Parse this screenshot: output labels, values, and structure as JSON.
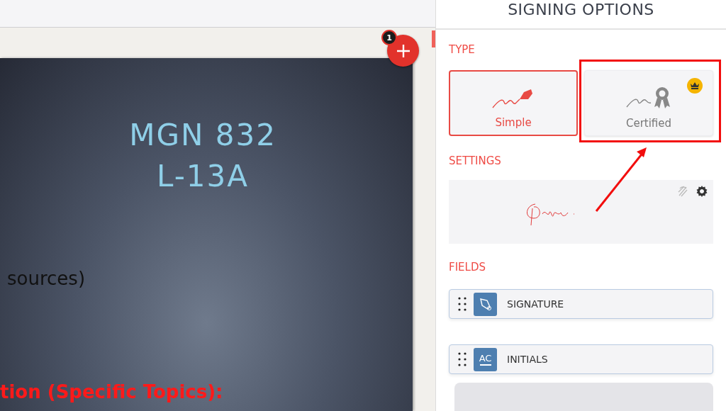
{
  "document": {
    "slide": {
      "title_lines": [
        "MGN 832",
        "L-13A"
      ],
      "body_text": "sources)",
      "heading_text": "tion (Specific Topics):"
    },
    "add_button": {
      "badge": "1"
    }
  },
  "panel": {
    "title": "SIGNING OPTIONS",
    "type_section": {
      "label": "TYPE",
      "options": [
        {
          "label": "Simple",
          "kind": "pen",
          "selected": true,
          "premium": false
        },
        {
          "label": "Certified",
          "kind": "seal",
          "selected": false,
          "premium": true
        }
      ]
    },
    "settings_section": {
      "label": "SETTINGS"
    },
    "fields_section": {
      "label": "FIELDS",
      "fields": [
        {
          "label": "SIGNATURE",
          "kind": "signature"
        },
        {
          "label": "INITIALS",
          "kind": "initials",
          "icon_text": "AC"
        }
      ]
    }
  }
}
